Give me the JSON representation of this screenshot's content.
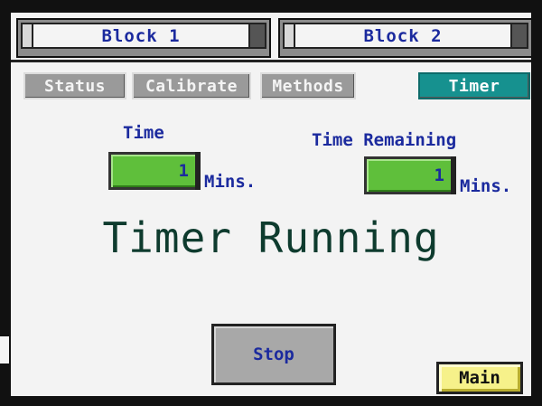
{
  "blocks": [
    {
      "label": "Block 1"
    },
    {
      "label": "Block 2"
    }
  ],
  "tabs": [
    {
      "label": "Status",
      "selected": false
    },
    {
      "label": "Calibrate",
      "selected": false
    },
    {
      "label": "Methods",
      "selected": false
    },
    {
      "label": "Timer",
      "selected": true
    }
  ],
  "time": {
    "label": "Time",
    "value": "1",
    "units": "Mins."
  },
  "remaining": {
    "label": "Time Remaining",
    "value": "1",
    "units": "Mins."
  },
  "status_text": "Timer Running",
  "buttons": {
    "stop": "Stop",
    "main": "Main"
  },
  "colors": {
    "label_blue": "#1b2a9e",
    "field_green": "#5fbf3b",
    "active_tab_teal": "#16918f",
    "inactive_tab_gray": "#9a9a9a",
    "main_yellow": "#f6f18a",
    "status_text_dark_green": "#0e3b2e"
  }
}
